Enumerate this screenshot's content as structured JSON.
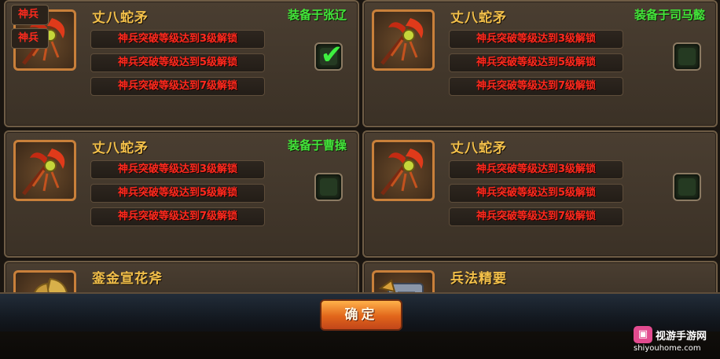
{
  "cards": [
    {
      "name": "丈八蛇矛",
      "equip": "装备于张辽",
      "unlocks": [
        "神兵突破等级达到3级解锁",
        "神兵突破等级达到5级解锁",
        "神兵突破等级达到7级解锁"
      ],
      "checked": true
    },
    {
      "name": "丈八蛇矛",
      "equip": "装备于司马懿",
      "unlocks": [
        "神兵突破等级达到3级解锁",
        "神兵突破等级达到5级解锁",
        "神兵突破等级达到7级解锁"
      ],
      "checked": false
    },
    {
      "name": "丈八蛇矛",
      "equip": "装备于曹操",
      "unlocks": [
        "神兵突破等级达到3级解锁",
        "神兵突破等级达到5级解锁",
        "神兵突破等级达到7级解锁"
      ],
      "checked": false
    },
    {
      "name": "丈八蛇矛",
      "equip": "",
      "unlocks": [
        "神兵突破等级达到3级解锁",
        "神兵突破等级达到5级解锁",
        "神兵突破等级达到7级解锁"
      ],
      "checked": false
    },
    {
      "name": "銮金宣花斧",
      "equip": "",
      "unlocks": [],
      "checked": false
    },
    {
      "name": "兵法精要",
      "equip": "",
      "unlocks": [],
      "checked": false
    }
  ],
  "overlay_tabs": [
    "神兵",
    "神兵"
  ],
  "confirm_label": "确定",
  "watermark": {
    "title": "视游手游网",
    "url": "shiyouhome.com"
  }
}
